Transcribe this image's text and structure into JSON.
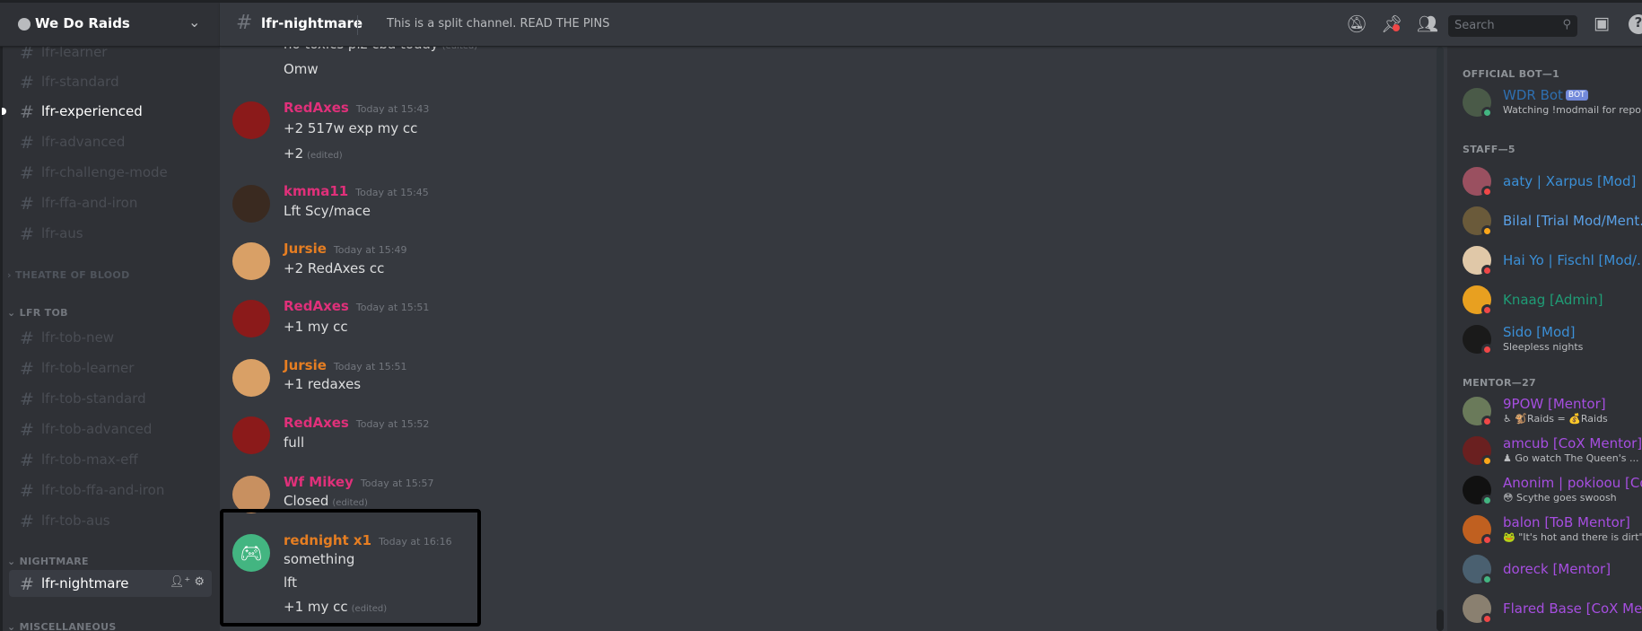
{
  "server": {
    "name": "We Do Raids"
  },
  "sidebar": {
    "channels_top": [
      "lfr-learner",
      "lfr-standard",
      "lfr-experienced",
      "lfr-advanced",
      "lfr-challenge-mode",
      "lfr-ffa-and-iron",
      "lfr-aus"
    ],
    "unread_channel": "lfr-experienced",
    "categories": {
      "tob": "THEATRE OF BLOOD",
      "lfr_tob": "LFR TOB",
      "nightmare": "NIGHTMARE",
      "misc": "MISCELLANEOUS"
    },
    "lfr_tob_channels": [
      "lfr-tob-new",
      "lfr-tob-learner",
      "lfr-tob-standard",
      "lfr-tob-advanced",
      "lfr-tob-max-eff",
      "lfr-tob-ffa-and-iron",
      "lfr-tob-aus"
    ],
    "selected_channel": "lfr-nightmare"
  },
  "header": {
    "channel": "lfr-nightmare",
    "topic": "This is a split channel. READ THE PINS",
    "search_placeholder": "Search"
  },
  "messages": [
    {
      "lines": [
        {
          "text": "no toxics plz cba today",
          "edited": "(edited)"
        },
        {
          "text": "Omw"
        }
      ]
    },
    {
      "author": "RedAxes",
      "color": "#e0307a",
      "avatar": "#8b1a1a",
      "time": "Today at 15:43",
      "lines": [
        {
          "text": "+2 517w exp my cc"
        },
        {
          "text": "+2",
          "edited": "(edited)"
        }
      ]
    },
    {
      "author": "kmma11",
      "color": "#e0307a",
      "avatar": "#3a2a20",
      "time": "Today at 15:45",
      "lines": [
        {
          "text": "Lft Scy/mace"
        }
      ]
    },
    {
      "author": "Jursie",
      "color": "#e67e22",
      "avatar": "#d9a066",
      "time": "Today at 15:49",
      "lines": [
        {
          "text": "+2 RedAxes cc"
        }
      ]
    },
    {
      "author": "RedAxes",
      "color": "#e0307a",
      "avatar": "#8b1a1a",
      "time": "Today at 15:51",
      "lines": [
        {
          "text": "+1 my cc"
        }
      ]
    },
    {
      "author": "Jursie",
      "color": "#e67e22",
      "avatar": "#d9a066",
      "time": "Today at 15:51",
      "lines": [
        {
          "text": "+1 redaxes"
        }
      ]
    },
    {
      "author": "RedAxes",
      "color": "#e0307a",
      "avatar": "#8b1a1a",
      "time": "Today at 15:52",
      "lines": [
        {
          "text": "full"
        }
      ]
    },
    {
      "author": "Wf Mikey",
      "color": "#e0307a",
      "avatar": "#c89060",
      "time": "Today at 15:57",
      "lines": [
        {
          "text": "Closed",
          "edited": "(edited)"
        }
      ]
    },
    {
      "author": "rednight x1",
      "color": "#e67e22",
      "avatar": "#43b581",
      "time": "Today at 16:16",
      "lines": [
        {
          "text": "something"
        },
        {
          "text": "lft"
        },
        {
          "text": "+1 my cc",
          "edited": "(edited)"
        }
      ]
    }
  ],
  "members": {
    "groups": [
      {
        "title": "OFFICIAL BOT—1",
        "items": [
          {
            "name": "WDR Bot",
            "badge": "BOT",
            "sub": "Watching !modmail for reports",
            "color": "#2f6fb0",
            "avatar": "#4a5a48",
            "status": "online"
          }
        ]
      },
      {
        "title": "STAFF—5",
        "items": [
          {
            "name": "aaty | Xarpus [Mod]",
            "color": "#3b8fd6",
            "avatar": "#9a5060",
            "status": "dnd"
          },
          {
            "name": "Bilal [Trial Mod/Ment...",
            "color": "#5aa0e6",
            "avatar": "#6a5a3a",
            "status": "idle"
          },
          {
            "name": "Hai Yo | Fischl [Mod/...",
            "color": "#3b8fd6",
            "avatar": "#e0c8a8",
            "status": "dnd"
          },
          {
            "name": "Knaag [Admin]",
            "color": "#1f9d76",
            "avatar": "#e8a020",
            "status": "dnd"
          },
          {
            "name": "Sido [Mod]",
            "sub": "Sleepless nights",
            "color": "#3b8fd6",
            "avatar": "#1a1a1a",
            "status": "dnd"
          }
        ]
      },
      {
        "title": "MENTOR—27",
        "items": [
          {
            "name": "9POW [Mentor]",
            "sub": "♿ 🐒Raids = 💰Raids",
            "color": "#a64ee0",
            "avatar": "#6a7a5a",
            "status": "dnd"
          },
          {
            "name": "amcub [CoX Mentor]",
            "sub": "♟ Go watch The Queen's ...",
            "color": "#a64ee0",
            "avatar": "#6a2020",
            "status": "idle"
          },
          {
            "name": "Anonim | pokioou [Co...",
            "sub": "😳 Scythe goes swoosh",
            "color": "#a64ee0",
            "avatar": "#111111",
            "status": "online"
          },
          {
            "name": "balon [ToB Mentor]",
            "sub": "🐸 \"It's hot and there is dirt\"",
            "color": "#a64ee0",
            "avatar": "#c06020",
            "status": "dnd"
          },
          {
            "name": "doreck [Mentor]",
            "color": "#a64ee0",
            "avatar": "#4a6070",
            "status": "online"
          },
          {
            "name": "Flared Base [CoX Men...",
            "color": "#a64ee0",
            "avatar": "#8a8070",
            "status": "dnd"
          }
        ]
      }
    ]
  },
  "status_colors": {
    "online": "#43b581",
    "dnd": "#f04747",
    "idle": "#faa61a"
  }
}
